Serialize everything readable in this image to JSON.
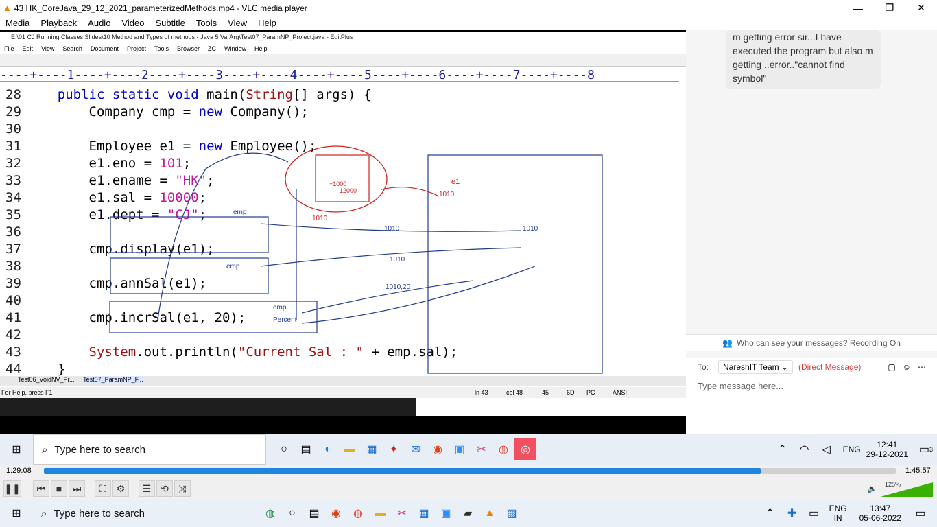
{
  "vlc": {
    "title": "43 HK_CoreJava_29_12_2021_parameterizedMethods.mp4 - VLC media player",
    "menu": [
      "Media",
      "Playback",
      "Audio",
      "Video",
      "Subtitle",
      "Tools",
      "View",
      "Help"
    ],
    "time_current": "1:29:08",
    "time_total": "1:45:57",
    "progress": 0.841,
    "volume_label": "125%",
    "volume_level": 1.0
  },
  "editplus": {
    "title": "E:\\01 CJ Running Classes Slides\\10 Method and Types of methods - Java 5 VarArg\\Test07_ParamNP_Project.java - EditPlus",
    "menu": [
      "File",
      "Edit",
      "View",
      "Search",
      "Document",
      "Project",
      "Tools",
      "Browser",
      "ZC",
      "Window",
      "Help"
    ],
    "ruler": "----+----1----+----2----+----3----+----4----+----5----+----6----+----7----+----8",
    "tabs": [
      "Test06_VoidNV_Pr...",
      "Test07_ParamNP_F..."
    ],
    "status_left": "For Help, press F1",
    "status_right": [
      "ln 43",
      "col 48",
      "45",
      "6D",
      "PC",
      "ANSI"
    ],
    "code": [
      {
        "n": "28",
        "t": "    public static void main(String[] args) {"
      },
      {
        "n": "29",
        "t": "        Company cmp = new Company();"
      },
      {
        "n": "30",
        "t": ""
      },
      {
        "n": "31",
        "t": "        Employee e1 = new Employee();"
      },
      {
        "n": "32",
        "t": "        e1.eno = 101;"
      },
      {
        "n": "33",
        "t": "        e1.ename = \"HK\";"
      },
      {
        "n": "34",
        "t": "        e1.sal = 10000;"
      },
      {
        "n": "35",
        "t": "        e1.dept = \"CJ\";"
      },
      {
        "n": "36",
        "t": ""
      },
      {
        "n": "37",
        "t": "        cmp.display(e1);"
      },
      {
        "n": "38",
        "t": ""
      },
      {
        "n": "39",
        "t": "        cmp.annSal(e1);"
      },
      {
        "n": "40",
        "t": ""
      },
      {
        "n": "41",
        "t": "        cmp.incrSal(e1, 20);"
      },
      {
        "n": "42",
        "t": ""
      },
      {
        "n": "43",
        "t": "        System.out.println(\"Current Sal : \" + emp.sal);"
      },
      {
        "n": "44",
        "t": "    }"
      }
    ]
  },
  "teams": {
    "message": "m getting error sir...I have executed the program but also m getting ..error..\"cannot find symbol\"",
    "notice": "Who can see your messages? Recording On",
    "to_label": "To:",
    "recipient": "NareshIT Team",
    "direct": "(Direct Message)",
    "placeholder": "Type message here..."
  },
  "video_taskbar": {
    "search": "Type here to search",
    "time": "12:41",
    "date": "29-12-2021",
    "lang": "ENG",
    "notif": "3"
  },
  "host_taskbar": {
    "search": "Type here to search",
    "lang1": "ENG",
    "lang2": "IN",
    "time": "13:47",
    "date": "05-06-2022"
  },
  "sketch": {
    "labels": [
      "e1",
      "1010",
      "1010",
      "1010",
      "1010",
      "1010",
      "1010,20",
      "emp",
      "emp",
      "emp",
      "Percent",
      "+1000",
      "12000"
    ]
  }
}
